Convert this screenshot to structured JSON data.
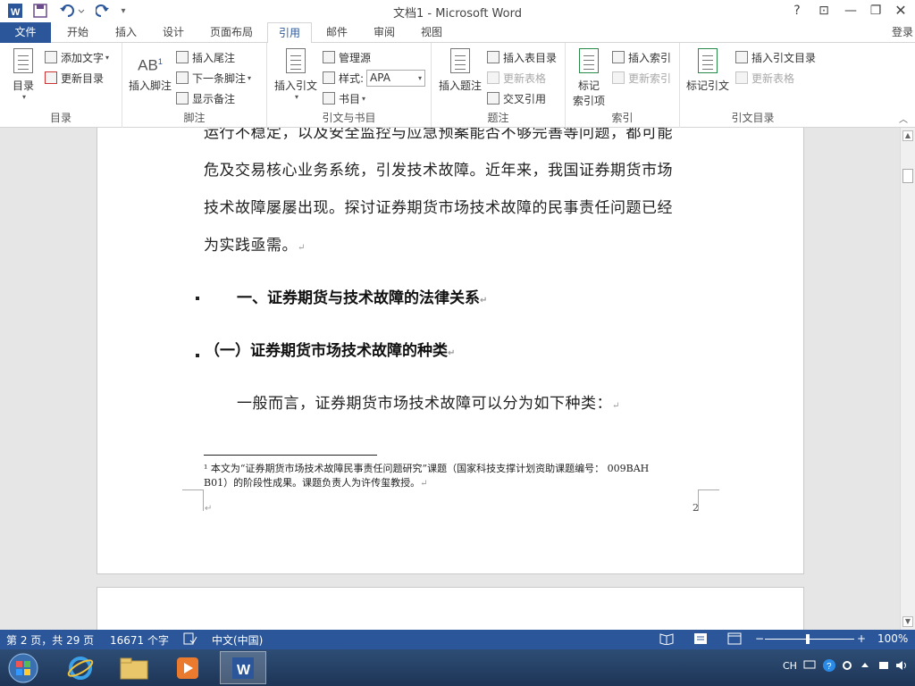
{
  "window": {
    "title": "文档1 - Microsoft Word",
    "help": "?",
    "controls": [
      "⊡",
      "—",
      "❐",
      "✕"
    ]
  },
  "tabs": [
    "文件",
    "开始",
    "插入",
    "设计",
    "页面布局",
    "引用",
    "邮件",
    "审阅",
    "视图"
  ],
  "active_tab": "引用",
  "login": "登录",
  "ribbon": {
    "toc": {
      "big": "目录",
      "add_text": "添加文字",
      "update": "更新目录",
      "group": "目录"
    },
    "footnotes": {
      "big": "插入脚注",
      "insert_endnote": "插入尾注",
      "next_footnote": "下一条脚注",
      "show_notes": "显示备注",
      "group": "脚注",
      "ab_glyph": "AB",
      "ab_sup": "1"
    },
    "citations": {
      "big": "插入引文",
      "manage": "管理源",
      "style_label": "样式:",
      "style_value": "APA",
      "bibliography": "书目",
      "group": "引文与书目"
    },
    "captions": {
      "big": "插入题注",
      "insert_tof": "插入表目录",
      "update_table": "更新表格",
      "cross_ref": "交叉引用",
      "group": "题注"
    },
    "index": {
      "big_line1": "标记",
      "big_line2": "索引项",
      "insert_index": "插入索引",
      "update_index": "更新索引",
      "group": "索引"
    },
    "toa": {
      "big": "标记引文",
      "insert_toa": "插入引文目录",
      "update_table": "更新表格",
      "group": "引文目录"
    }
  },
  "document": {
    "lines": [
      "运行不稳定，以及安全监控与应急预案能否不够完善等问题，都可能",
      "危及交易核心业务系统，引发技术故障。近年来，我国证券期货市场",
      "技术故障屡屡出现。探讨证券期货市场技术故障的民事责任问题已经",
      "为实践亟需。"
    ],
    "heading1": "一、证券期货与技术故障的法律关系",
    "heading2": "（一）证券期货市场技术故障的种类",
    "paragraph": "一般而言，证券期货市场技术故障可以分为如下种类：",
    "para_mark": "↵",
    "footnote_line1": "¹ 本文为“证券期货市场技术故障民事责任问题研究”课题（国家科技支撑计划资助课题编号： 009BAH",
    "footnote_line2": "B01）的阶段性成果。课题负责人为许传玺教授。",
    "page_number": "2"
  },
  "status": {
    "page": "第 2 页，共 29 页",
    "words": "16671 个字",
    "language": "中文(中国)",
    "zoom": "100%",
    "zoom_minus": "−",
    "zoom_plus": "+"
  },
  "taskbar": {
    "tray_lang": "CH"
  },
  "colors": {
    "accent": "#2b579a",
    "taskbar": "#1d3556"
  }
}
